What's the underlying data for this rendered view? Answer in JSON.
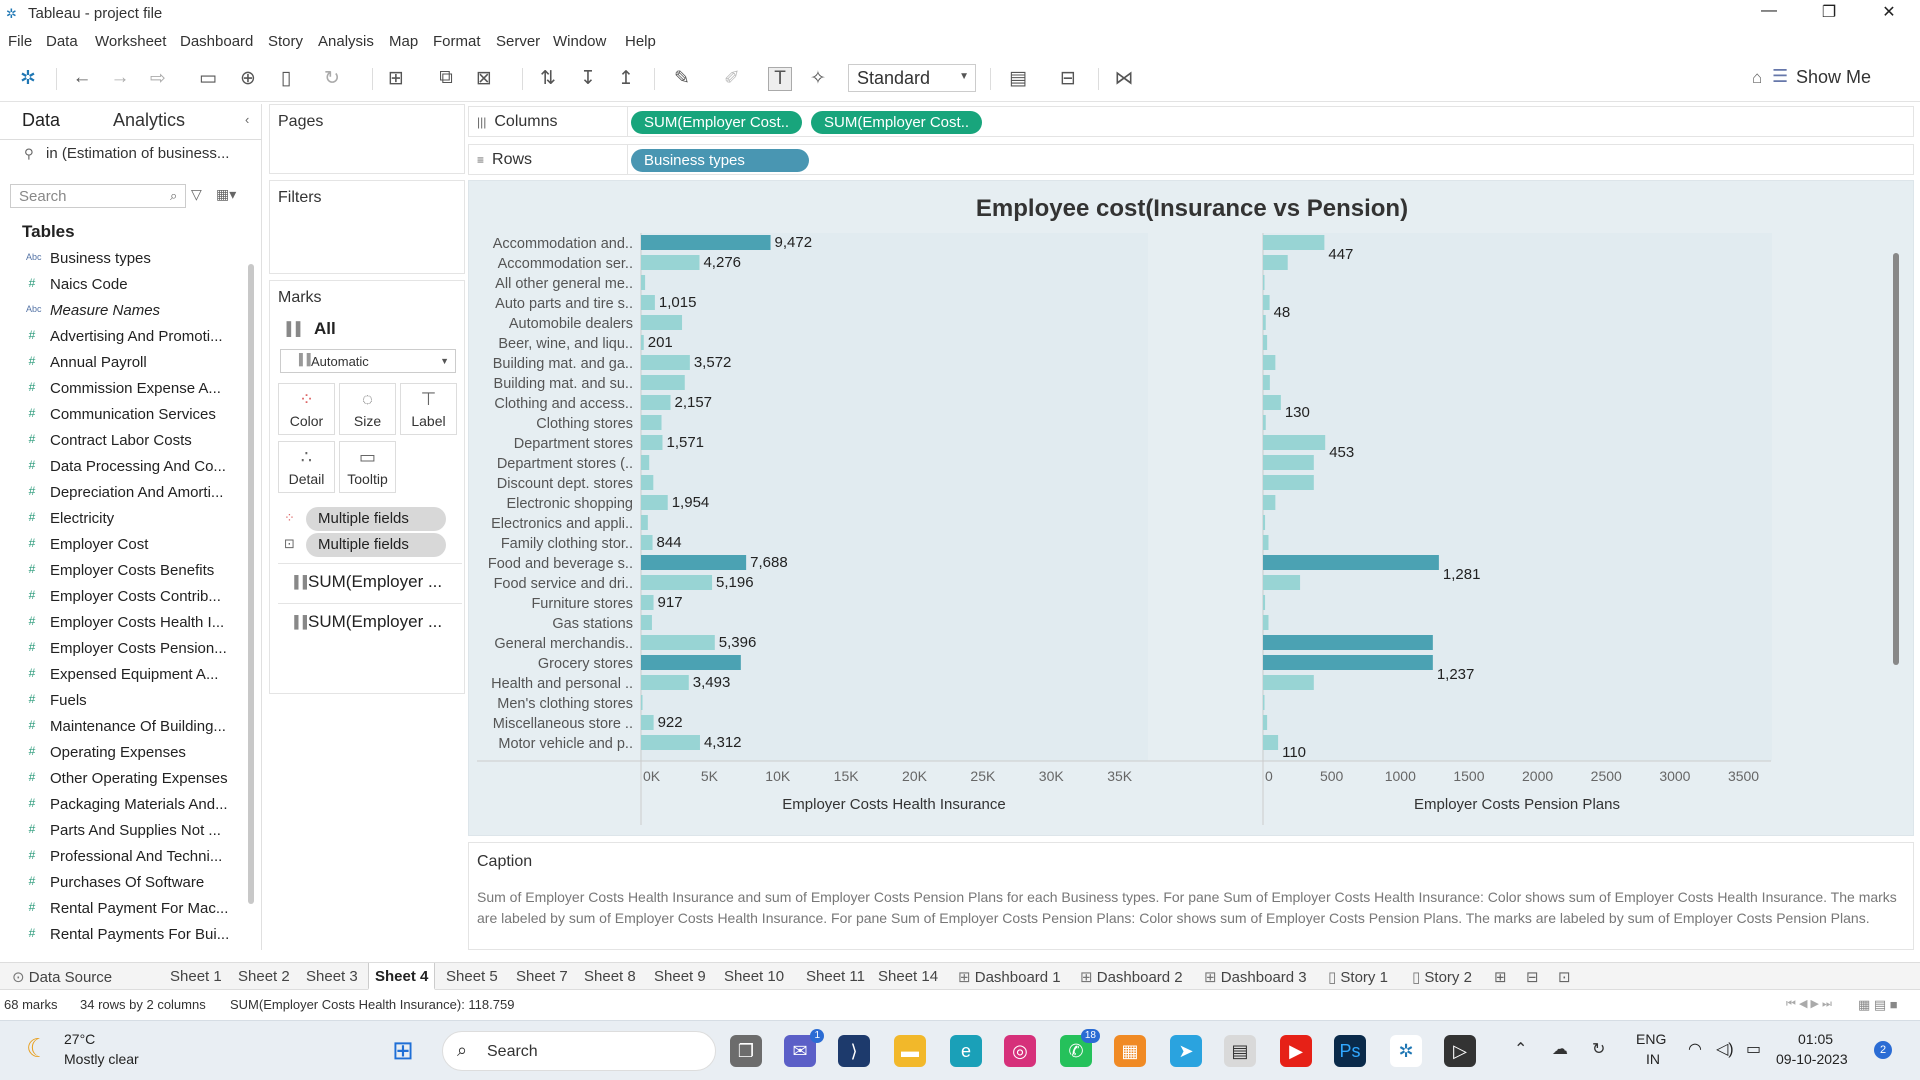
{
  "window": {
    "title": "Tableau - project file"
  },
  "menu": [
    "File",
    "Data",
    "Worksheet",
    "Dashboard",
    "Story",
    "Analysis",
    "Map",
    "Format",
    "Server",
    "Window",
    "Help"
  ],
  "toolbar": {
    "fit_select": "Standard",
    "show_me": "Show Me"
  },
  "data_pane": {
    "tab_data": "Data",
    "tab_analytics": "Analytics",
    "datasource": "in (Estimation of business...",
    "search_placeholder": "Search",
    "tables_title": "Tables",
    "fields": [
      {
        "name": "Business types",
        "type": "abc"
      },
      {
        "name": "Naics Code",
        "type": "num"
      },
      {
        "name": "Measure Names",
        "type": "abc",
        "italic": true
      },
      {
        "name": "Advertising And Promoti...",
        "type": "num"
      },
      {
        "name": "Annual Payroll",
        "type": "num"
      },
      {
        "name": "Commission Expense A...",
        "type": "num"
      },
      {
        "name": "Communication Services",
        "type": "num"
      },
      {
        "name": "Contract Labor Costs",
        "type": "num"
      },
      {
        "name": "Data Processing And Co...",
        "type": "num"
      },
      {
        "name": "Depreciation And Amorti...",
        "type": "num"
      },
      {
        "name": "Electricity",
        "type": "num"
      },
      {
        "name": "Employer Cost",
        "type": "num"
      },
      {
        "name": "Employer Costs Benefits",
        "type": "num"
      },
      {
        "name": "Employer Costs Contrib...",
        "type": "num"
      },
      {
        "name": "Employer Costs Health I...",
        "type": "num"
      },
      {
        "name": "Employer Costs Pension...",
        "type": "num"
      },
      {
        "name": "Expensed Equipment A...",
        "type": "num"
      },
      {
        "name": "Fuels",
        "type": "num"
      },
      {
        "name": "Maintenance Of Building...",
        "type": "num"
      },
      {
        "name": "Operating Expenses",
        "type": "num"
      },
      {
        "name": "Other Operating Expenses",
        "type": "num"
      },
      {
        "name": "Packaging Materials And...",
        "type": "num"
      },
      {
        "name": "Parts And Supplies Not ...",
        "type": "num"
      },
      {
        "name": "Professional And Techni...",
        "type": "num"
      },
      {
        "name": "Purchases Of Software",
        "type": "num"
      },
      {
        "name": "Rental Payment For Mac...",
        "type": "num"
      },
      {
        "name": "Rental Payments For Bui...",
        "type": "num"
      }
    ]
  },
  "cards": {
    "pages": "Pages",
    "filters": "Filters",
    "marks": "Marks",
    "marks_all": "All",
    "mark_type": "Automatic",
    "buttons": {
      "color": "Color",
      "size": "Size",
      "label": "Label",
      "detail": "Detail",
      "tooltip": "Tooltip"
    },
    "pill1": "Multiple fields",
    "pill2": "Multiple fields",
    "measure1": "SUM(Employer ...",
    "measure2": "SUM(Employer ..."
  },
  "shelves": {
    "columns_label": "Columns",
    "rows_label": "Rows",
    "col_pill1": "SUM(Employer Cost..",
    "col_pill2": "SUM(Employer Cost..",
    "row_pill": "Business types"
  },
  "chart_data": {
    "type": "bar",
    "title": "Employee cost(Insurance vs Pension)",
    "orientation": "horizontal",
    "categories": [
      "Accommodation and..",
      "Accommodation ser..",
      "All other general me..",
      "Auto parts and tire s..",
      "Automobile dealers",
      "Beer, wine, and liqu..",
      "Building mat. and ga..",
      "Building mat. and su..",
      "Clothing and access..",
      "Clothing stores",
      "Department stores",
      "Department stores (..",
      "Discount dept. stores",
      "Electronic shopping",
      "Electronics and appli..",
      "Family clothing stor..",
      "Food and beverage s..",
      "Food service and dri..",
      "Furniture stores",
      "Gas stations",
      "General merchandis..",
      "Grocery stores",
      "Health and personal ..",
      "Men's clothing stores",
      "Miscellaneous store ..",
      "Motor vehicle and p.."
    ],
    "series": [
      {
        "name": "Employer Costs Health Insurance",
        "values": [
          9472,
          4276,
          300,
          1015,
          3000,
          201,
          3572,
          3200,
          2157,
          1500,
          1571,
          600,
          900,
          1954,
          500,
          844,
          7688,
          5196,
          917,
          800,
          5396,
          7300,
          3493,
          100,
          922,
          4312
        ],
        "labels": [
          "9,472",
          "4,276",
          "",
          "1,015",
          "",
          "201",
          "3,572",
          "",
          "2,157",
          "",
          "1,571",
          "",
          "",
          "1,954",
          "",
          "844",
          "7,688",
          "5,196",
          "917",
          "",
          "5,396",
          "",
          "3,493",
          "",
          "922",
          "4,312"
        ],
        "xlim": [
          0,
          37000
        ],
        "ticks": [
          "0K",
          "5K",
          "10K",
          "15K",
          "20K",
          "25K",
          "30K",
          "35K"
        ],
        "xlabel": "Employer Costs Health Insurance"
      },
      {
        "name": "Employer Costs Pension Plans",
        "values": [
          447,
          180,
          5,
          48,
          20,
          30,
          90,
          50,
          130,
          20,
          453,
          370,
          370,
          90,
          15,
          40,
          1281,
          270,
          15,
          40,
          1237,
          1237,
          370,
          2,
          30,
          110
        ],
        "labels": [
          "447",
          "",
          "",
          "48",
          "",
          "",
          "",
          "",
          "130",
          "",
          "453",
          "",
          "",
          "",
          "",
          "",
          "1,281",
          "",
          "",
          "",
          "",
          "1,237",
          "",
          "",
          "",
          "110"
        ],
        "xlim": [
          0,
          3700
        ],
        "ticks": [
          "0",
          "500",
          "1000",
          "1500",
          "2000",
          "2500",
          "3000",
          "3500"
        ],
        "xlabel": "Employer Costs Pension Plans"
      }
    ]
  },
  "caption": {
    "title": "Caption",
    "text": "Sum of Employer Costs Health Insurance and sum of Employer Costs Pension Plans for each Business types.  For pane Sum of Employer Costs Health Insurance:  Color shows sum of Employer Costs Health Insurance.  The marks are labeled by sum of Employer Costs Health Insurance.  For pane Sum of Employer Costs Pension Plans:  Color shows sum of Employer Costs Pension Plans.  The marks are labeled by sum of Employer Costs Pension Plans."
  },
  "sheet_tabs": {
    "datasource": "Data Source",
    "tabs": [
      "Sheet 1",
      "Sheet 2",
      "Sheet 3",
      "Sheet 4",
      "Sheet 5",
      "Sheet 7",
      "Sheet 8",
      "Sheet 9",
      "Sheet 10",
      "Sheet 11",
      "Sheet 14",
      "Dashboard 1",
      "Dashboard 2",
      "Dashboard 3",
      "Story 1",
      "Story 2"
    ],
    "active": "Sheet 4"
  },
  "status": {
    "marks": "68 marks",
    "rows_cols": "34 rows by 2 columns",
    "sum": "SUM(Employer Costs Health Insurance): 118.759"
  },
  "taskbar": {
    "weather_temp": "27°C",
    "weather_desc": "Mostly clear",
    "search": "Search",
    "lang1": "ENG",
    "lang2": "IN",
    "time": "01:05",
    "date": "09-10-2023",
    "teams_badge": "1",
    "whatsapp_badge": "18",
    "notif_badge": "2"
  },
  "colors": {
    "bar": "#98d4d4",
    "bar_dark": "#4ba2b3",
    "green_pill": "#18a57c",
    "blue_pill": "#4996b2"
  }
}
